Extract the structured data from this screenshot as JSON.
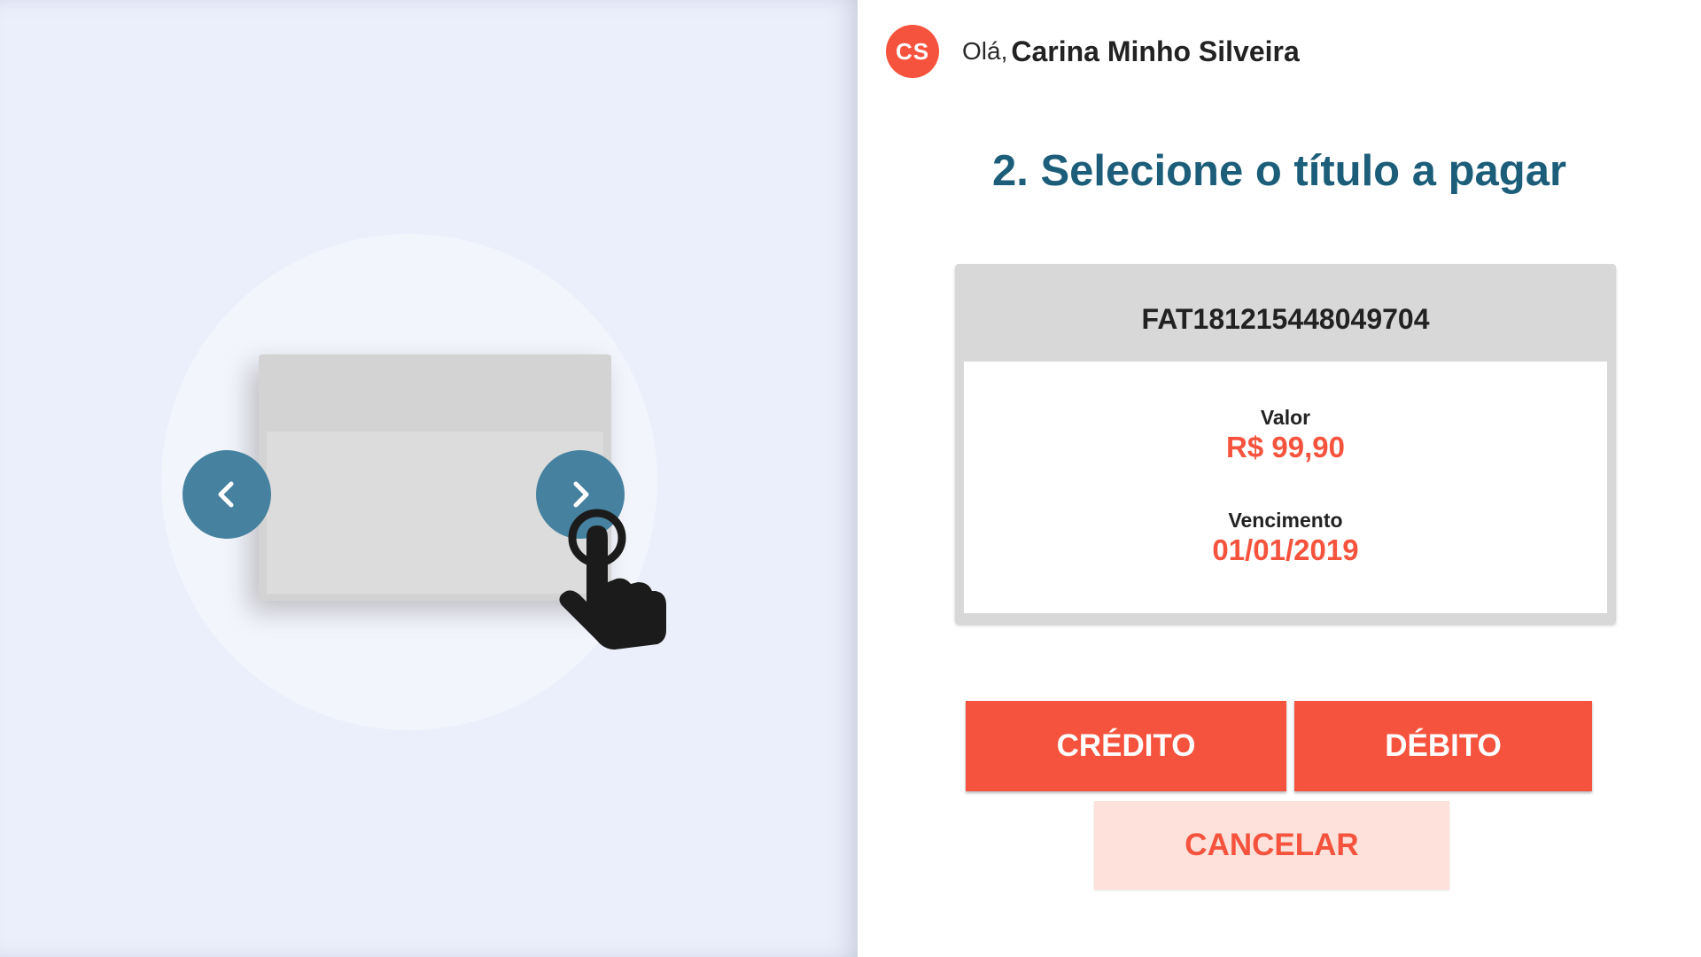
{
  "illustration": {
    "prev_icon": "chevron-left-icon",
    "next_icon": "chevron-right-icon",
    "hand_icon": "tap-hand-icon"
  },
  "header": {
    "avatar_initials": "CS",
    "greeting": "Olá,",
    "user_name": "Carina Minho Silveira"
  },
  "step_title": "2. Selecione o título a pagar",
  "invoice": {
    "id": "FAT181215448049704",
    "amount_label": "Valor",
    "amount": "R$ 99,90",
    "due_label": "Vencimento",
    "due_date": "01/01/2019"
  },
  "actions": {
    "credit": "CRÉDITO",
    "debit": "DÉBITO",
    "cancel": "CANCELAR"
  },
  "colors": {
    "accent": "#f5533d",
    "title": "#1c5e7a",
    "nav_arrow": "#46819f",
    "cancel_bg": "#fde1da",
    "left_panel_bg": "#eaeffb"
  }
}
